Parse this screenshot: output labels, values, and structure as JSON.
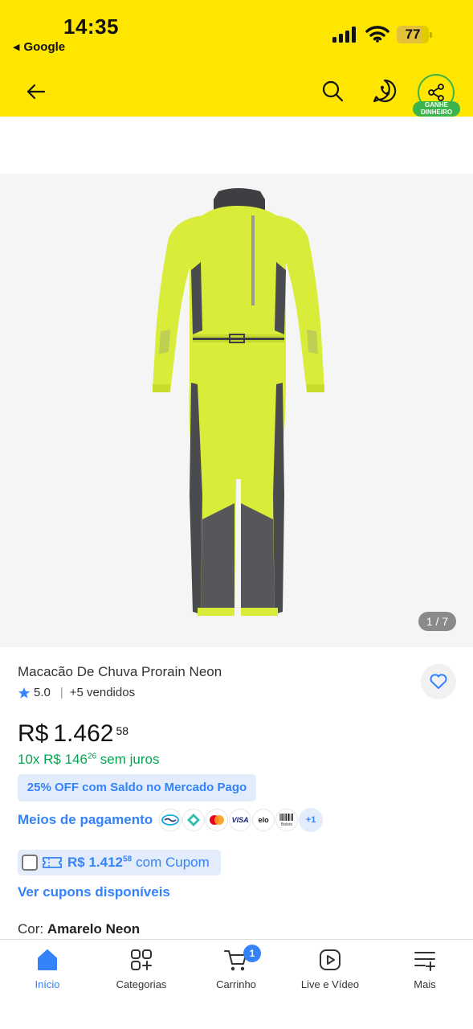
{
  "status_bar": {
    "time": "14:35",
    "back_app": "Google",
    "battery": "77",
    "battery_level": 0.77
  },
  "header": {
    "share_badge_line1": "GANHE",
    "share_badge_line2": "DINHEIRO"
  },
  "gallery": {
    "counter": "1 / 7",
    "image_alt": "Macacão de chuva amarelo neon"
  },
  "product": {
    "title": "Macacão De Chuva Prorain Neon",
    "rating": "5.0",
    "sold": "+5 vendidos",
    "price": {
      "currency": "R$",
      "integer": "1.462",
      "cents": "58"
    },
    "installments": {
      "prefix": "10x R$ 146",
      "cents": "26",
      "suffix": " sem juros"
    },
    "discount_badge": "25% OFF com Saldo no Mercado Pago",
    "payment_link": "Meios de pagamento",
    "payment_methods": [
      "mercado-pago",
      "pix",
      "mastercard",
      "VISA",
      "elo",
      "Boleto"
    ],
    "payment_more": "+1",
    "coupon": {
      "price": "R$ 1.412",
      "cents": "58",
      "text": "com Cupom"
    },
    "coupons_link": "Ver cupons disponíveis",
    "color_label": "Cor:",
    "color_value": "Amarelo Neon"
  },
  "tabbar": {
    "items": [
      {
        "label": "Início",
        "icon": "home-icon",
        "active": true
      },
      {
        "label": "Categorias",
        "icon": "categories-icon"
      },
      {
        "label": "Carrinho",
        "icon": "cart-icon",
        "badge": "1"
      },
      {
        "label": "Live e Vídeo",
        "icon": "play-icon"
      },
      {
        "label": "Mais",
        "icon": "menu-plus-icon"
      }
    ]
  },
  "colors": {
    "header_yellow": "#FFE600",
    "ml_blue": "#3483fa",
    "ml_green": "#00a650",
    "share_green": "#39b54a",
    "suit_neon": "#d9ec3a"
  }
}
